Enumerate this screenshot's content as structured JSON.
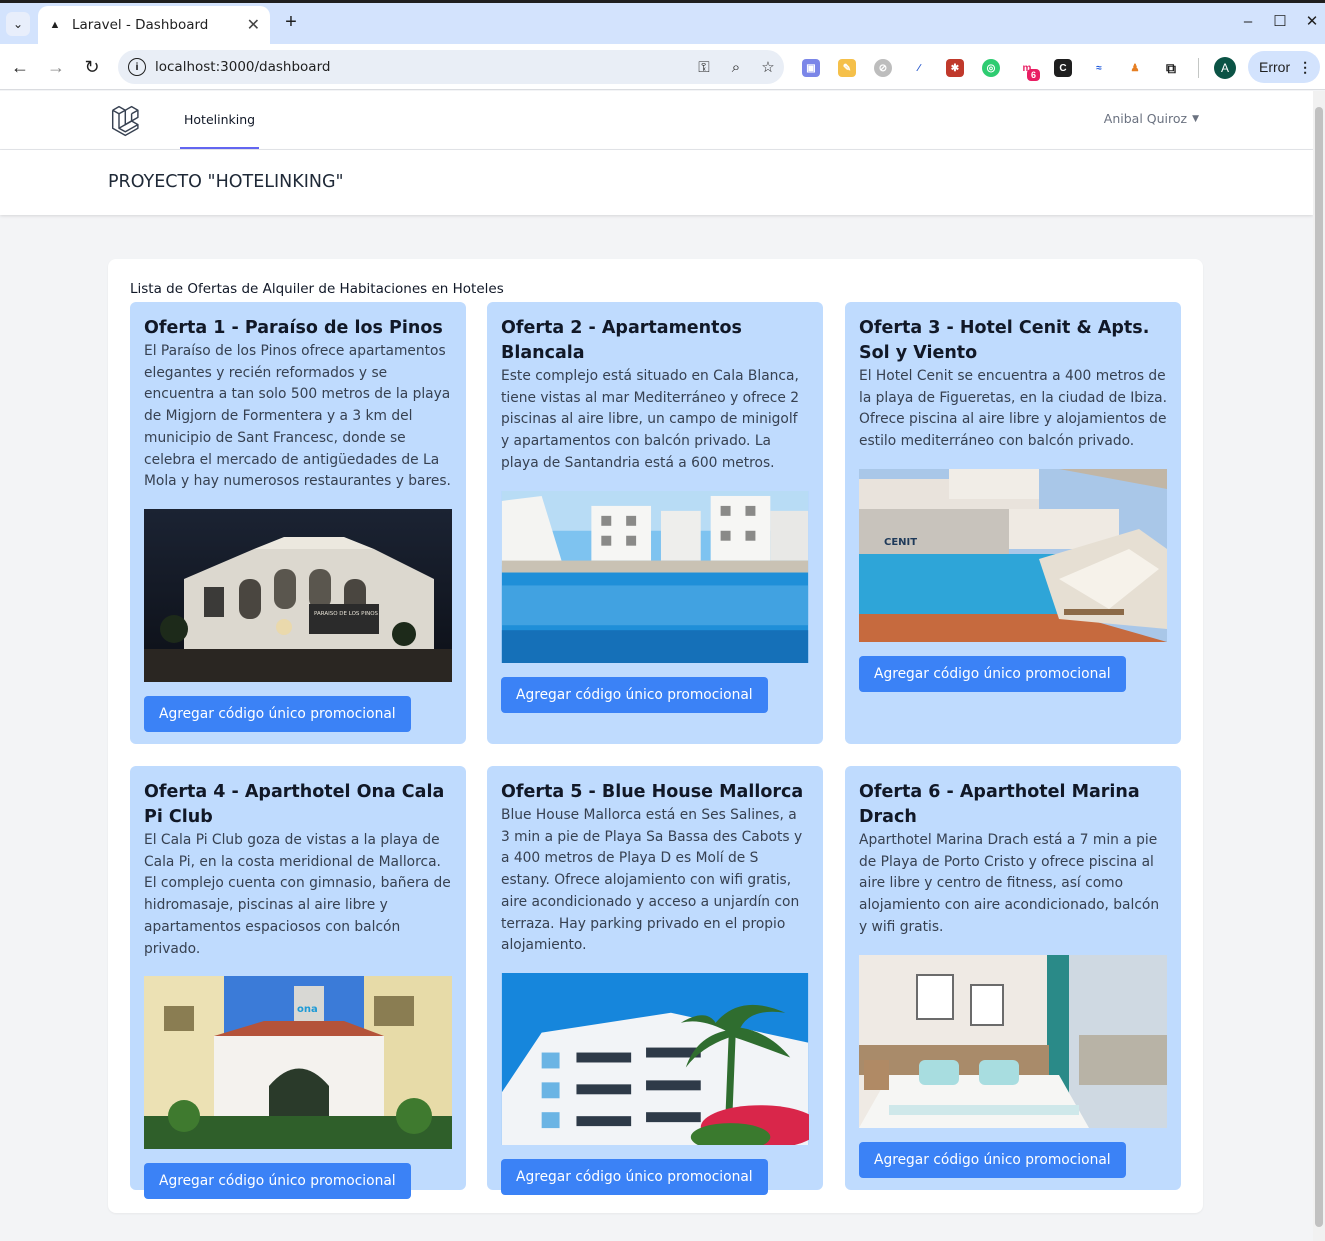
{
  "browser": {
    "tab_title": "Laravel - Dashboard",
    "url": "localhost:3000/dashboard",
    "error_label": "Error",
    "profile_initial": "A",
    "extension_badge": "6"
  },
  "app": {
    "nav_link": "Hotelinking",
    "user_name": "Anibal Quiroz",
    "page_title": "PROYECTO \"HOTELINKING\"",
    "list_heading": "Lista de Ofertas de Alquiler de Habitaciones en Hoteles"
  },
  "offers": [
    {
      "title": "Oferta 1 - Paraíso de los Pinos",
      "description": "El Paraíso de los Pinos ofrece apartamentos elegantes y recién reformados y se encuentra a tan solo 500 metros de la playa de Migjorn de Formentera y a 3 km del municipio de Sant Francesc, donde se celebra el mercado de antigüedades de La Mola y hay numerosos restaurantes y bares.",
      "button": "Agregar código único promocional",
      "sign_text": "PARAISO DE LOS PINOS"
    },
    {
      "title": "Oferta 2 - Apartamentos Blancala",
      "description": "Este complejo está situado en Cala Blanca, tiene vistas al mar Mediterráneo y ofrece 2 piscinas al aire libre, un campo de minigolf y apartamentos con balcón privado. La playa de Santandria está a 600 metros.",
      "button": "Agregar código único promocional"
    },
    {
      "title": "Oferta 3 - Hotel Cenit & Apts. Sol y Viento",
      "description": "El Hotel Cenit se encuentra a 400 metros de la playa de Figueretas, en la ciudad de Ibiza. Ofrece piscina al aire libre y alojamientos de estilo mediterráneo con balcón privado.",
      "button": "Agregar código único promocional",
      "sign_text": "CENIT"
    },
    {
      "title": "Oferta 4 - Aparthotel Ona Cala Pi Club",
      "description": "El Cala Pi Club goza de vistas a la playa de Cala Pi, en la costa meridional de Mallorca. El complejo cuenta con gimnasio, bañera de hidromasaje, piscinas al aire libre y apartamentos espaciosos con balcón privado.",
      "button": "Agregar código único promocional",
      "sign_text": "ona"
    },
    {
      "title": "Oferta 5 - Blue House Mallorca",
      "description": "Blue House Mallorca está en Ses Salines, a 3 min a pie de Playa Sa Bassa des Cabots y a 400 metros de Playa D es Molí de S estany. Ofrece alojamiento con wifi gratis, aire acondicionado y acceso a unjardín con terraza. Hay parking privado en el propio alojamiento.",
      "button": "Agregar código único promocional"
    },
    {
      "title": "Oferta 6 - Aparthotel Marina Drach",
      "description": "Aparthotel Marina Drach está a 7 min a pie de Playa de Porto Cristo y ofrece piscina al aire libre y centro de fitness, así como alojamiento con aire acondicionado, balcón y wifi gratis.",
      "button": "Agregar código único promocional"
    }
  ],
  "colors": {
    "card_bg": "#bfdbfe",
    "button_bg": "#3b82f6",
    "nav_active": "#6366f1",
    "tabstrip": "#d3e3fd"
  },
  "icons": {
    "back": "arrow-left-icon",
    "forward": "arrow-right-icon",
    "reload": "reload-icon",
    "logo": "laravel-logo"
  }
}
